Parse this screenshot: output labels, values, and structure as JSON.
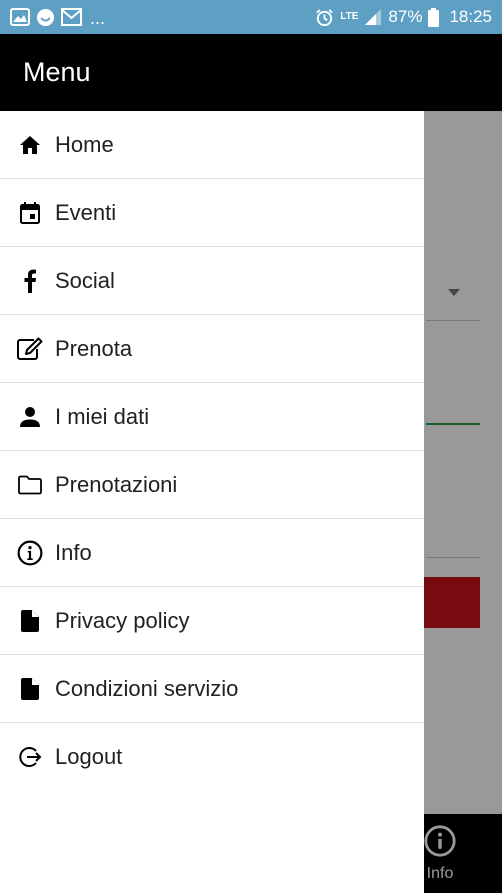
{
  "status_bar": {
    "icons_left": [
      "gallery-icon",
      "smiley-icon",
      "mail-icon"
    ],
    "overflow": "...",
    "network": "LTE",
    "battery": "87%",
    "time": "18:25"
  },
  "drawer": {
    "title": "Menu",
    "items": [
      {
        "label": "Home",
        "icon": "home-icon"
      },
      {
        "label": "Eventi",
        "icon": "calendar-icon"
      },
      {
        "label": "Social",
        "icon": "facebook-icon"
      },
      {
        "label": "Prenota",
        "icon": "edit-icon"
      },
      {
        "label": "I miei dati",
        "icon": "person-icon"
      },
      {
        "label": "Prenotazioni",
        "icon": "folder-icon"
      },
      {
        "label": "Info",
        "icon": "info-icon"
      },
      {
        "label": "Privacy policy",
        "icon": "document-icon"
      },
      {
        "label": "Condizioni servizio",
        "icon": "document-icon"
      },
      {
        "label": "Logout",
        "icon": "logout-icon"
      }
    ]
  },
  "background_app": {
    "bottom_nav_info_label": "Info",
    "colors": {
      "accent_green": "#2e9b46",
      "accent_red": "#c8131a"
    }
  }
}
